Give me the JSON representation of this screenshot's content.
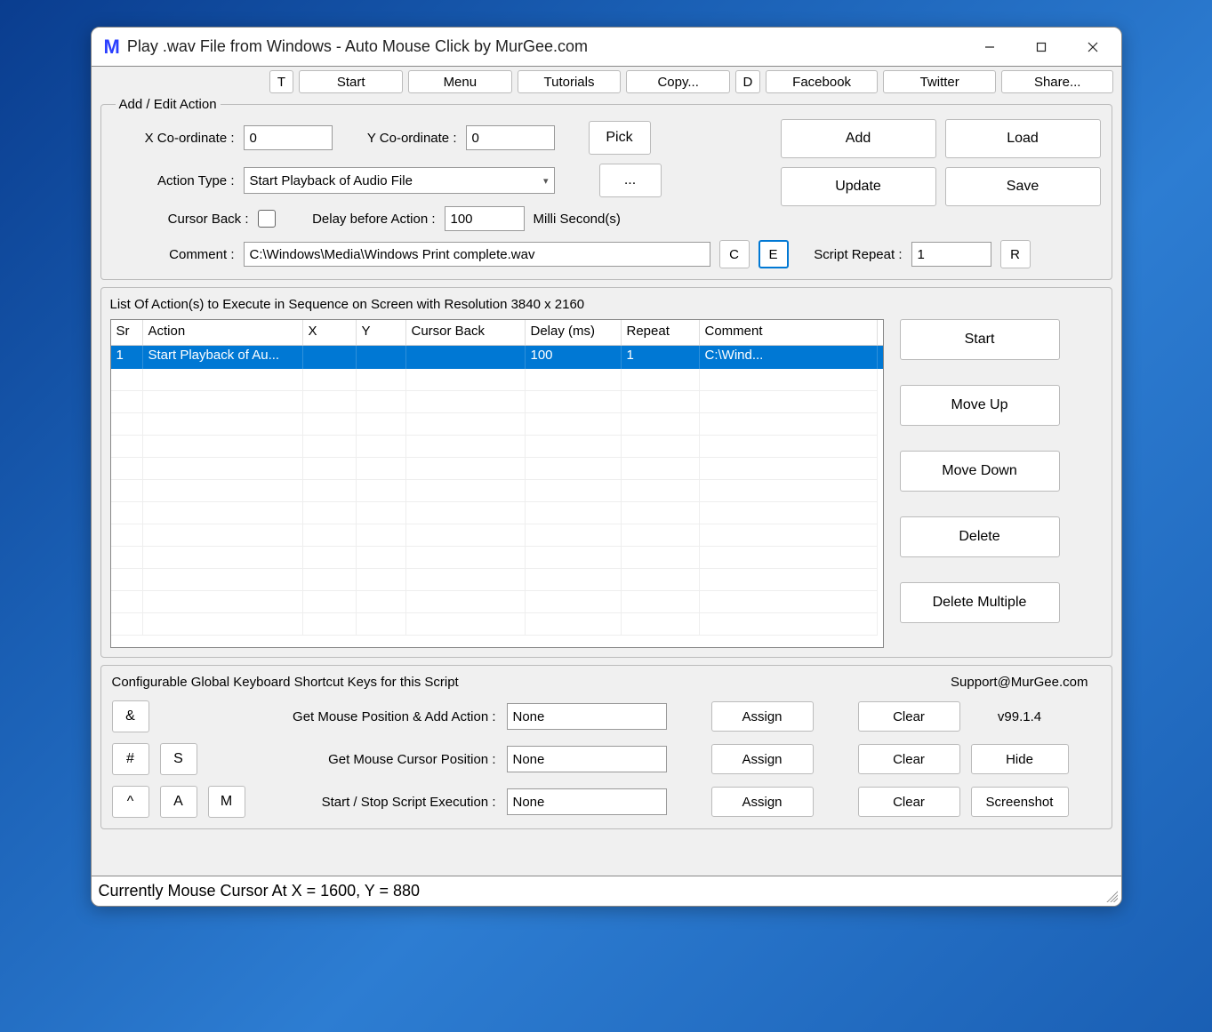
{
  "title": "Play .wav File from Windows - Auto Mouse Click by MurGee.com",
  "toolbar": {
    "t": "T",
    "start": "Start",
    "menu": "Menu",
    "tutorials": "Tutorials",
    "copy": "Copy...",
    "d": "D",
    "facebook": "Facebook",
    "twitter": "Twitter",
    "share": "Share..."
  },
  "edit": {
    "legend": "Add / Edit Action",
    "xlabel": "X Co-ordinate :",
    "xval": "0",
    "ylabel": "Y Co-ordinate :",
    "yval": "0",
    "pick": "Pick",
    "actiontype_label": "Action Type :",
    "actiontype_value": "Start Playback of Audio File",
    "dots": "...",
    "cursorback_label": "Cursor Back :",
    "delaylabel": "Delay before Action :",
    "delayval": "100",
    "delayunit": "Milli Second(s)",
    "comment_label": "Comment :",
    "comment_val": "C:\\Windows\\Media\\Windows Print complete.wav",
    "c": "C",
    "e": "E",
    "scriptrepeat_label": "Script Repeat :",
    "scriptrepeat_val": "1",
    "r": "R",
    "add": "Add",
    "load": "Load",
    "update": "Update",
    "save": "Save"
  },
  "list": {
    "label": "List Of Action(s) to Execute in Sequence on Screen with Resolution 3840 x 2160",
    "headers": {
      "sr": "Sr",
      "action": "Action",
      "x": "X",
      "y": "Y",
      "cb": "Cursor Back",
      "delay": "Delay (ms)",
      "repeat": "Repeat",
      "comment": "Comment"
    },
    "row": {
      "sr": "1",
      "action": "Start Playback of Au...",
      "x": "",
      "y": "",
      "cb": "",
      "delay": "100",
      "repeat": "1",
      "comment": "C:\\Wind..."
    },
    "buttons": {
      "start": "Start",
      "moveup": "Move Up",
      "movedown": "Move Down",
      "delete": "Delete",
      "deletemultiple": "Delete Multiple"
    }
  },
  "shortcuts": {
    "legend": "Configurable Global Keyboard Shortcut Keys for this Script",
    "support": "Support@MurGee.com",
    "amp": "&",
    "hash": "#",
    "s": "S",
    "caret": "^",
    "a": "A",
    "m": "M",
    "lbl_addaction": "Get Mouse Position & Add Action :",
    "lbl_getpos": "Get Mouse Cursor Position :",
    "lbl_startstop": "Start / Stop Script Execution :",
    "none1": "None",
    "none2": "None",
    "none3": "None",
    "assign": "Assign",
    "clear": "Clear",
    "version": "v99.1.4",
    "hide": "Hide",
    "screenshot": "Screenshot"
  },
  "status": "Currently Mouse Cursor At X = 1600, Y = 880"
}
